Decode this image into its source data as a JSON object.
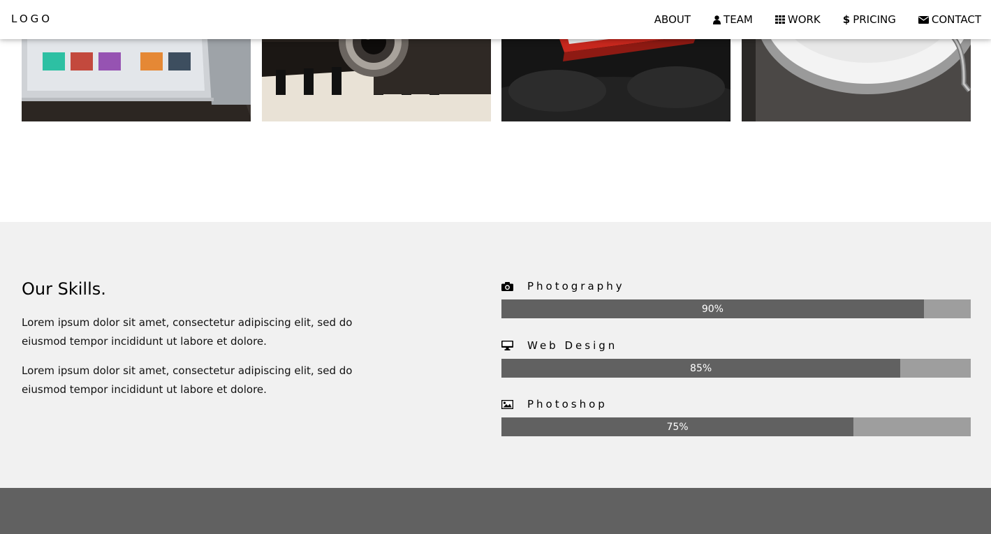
{
  "header": {
    "logo": "LOGO",
    "nav": [
      {
        "label": "ABOUT",
        "icon": ""
      },
      {
        "label": "TEAM",
        "icon": "user-icon"
      },
      {
        "label": "WORK",
        "icon": "grid-icon"
      },
      {
        "label": "PRICING",
        "icon": "dollar-icon"
      },
      {
        "label": "CONTACT",
        "icon": "envelope-icon"
      }
    ]
  },
  "gallery": {
    "photos": [
      {
        "subject": "tablet-with-apps"
      },
      {
        "subject": "camera-on-piano"
      },
      {
        "subject": "red-typewriter"
      },
      {
        "subject": "record-turntable"
      }
    ]
  },
  "skills": {
    "title": "Our Skills.",
    "paragraphs": [
      "Lorem ipsum dolor sit amet, consectetur adipiscing elit, sed do eiusmod tempor incididunt ut labore et dolore.",
      "Lorem ipsum dolor sit amet, consectetur adipiscing elit, sed do eiusmod tempor incididunt ut labore et dolore."
    ],
    "items": [
      {
        "name": "Photography",
        "icon": "camera-icon",
        "percent": 90,
        "label": "90%"
      },
      {
        "name": "Web Design",
        "icon": "monitor-icon",
        "percent": 85,
        "label": "85%"
      },
      {
        "name": "Photoshop",
        "icon": "image-icon",
        "percent": 75,
        "label": "75%"
      }
    ]
  },
  "colors": {
    "bar_fill": "#616161",
    "bar_track": "#9e9e9e",
    "section_bg": "#f1f1f1",
    "footer_bg": "#616161"
  }
}
